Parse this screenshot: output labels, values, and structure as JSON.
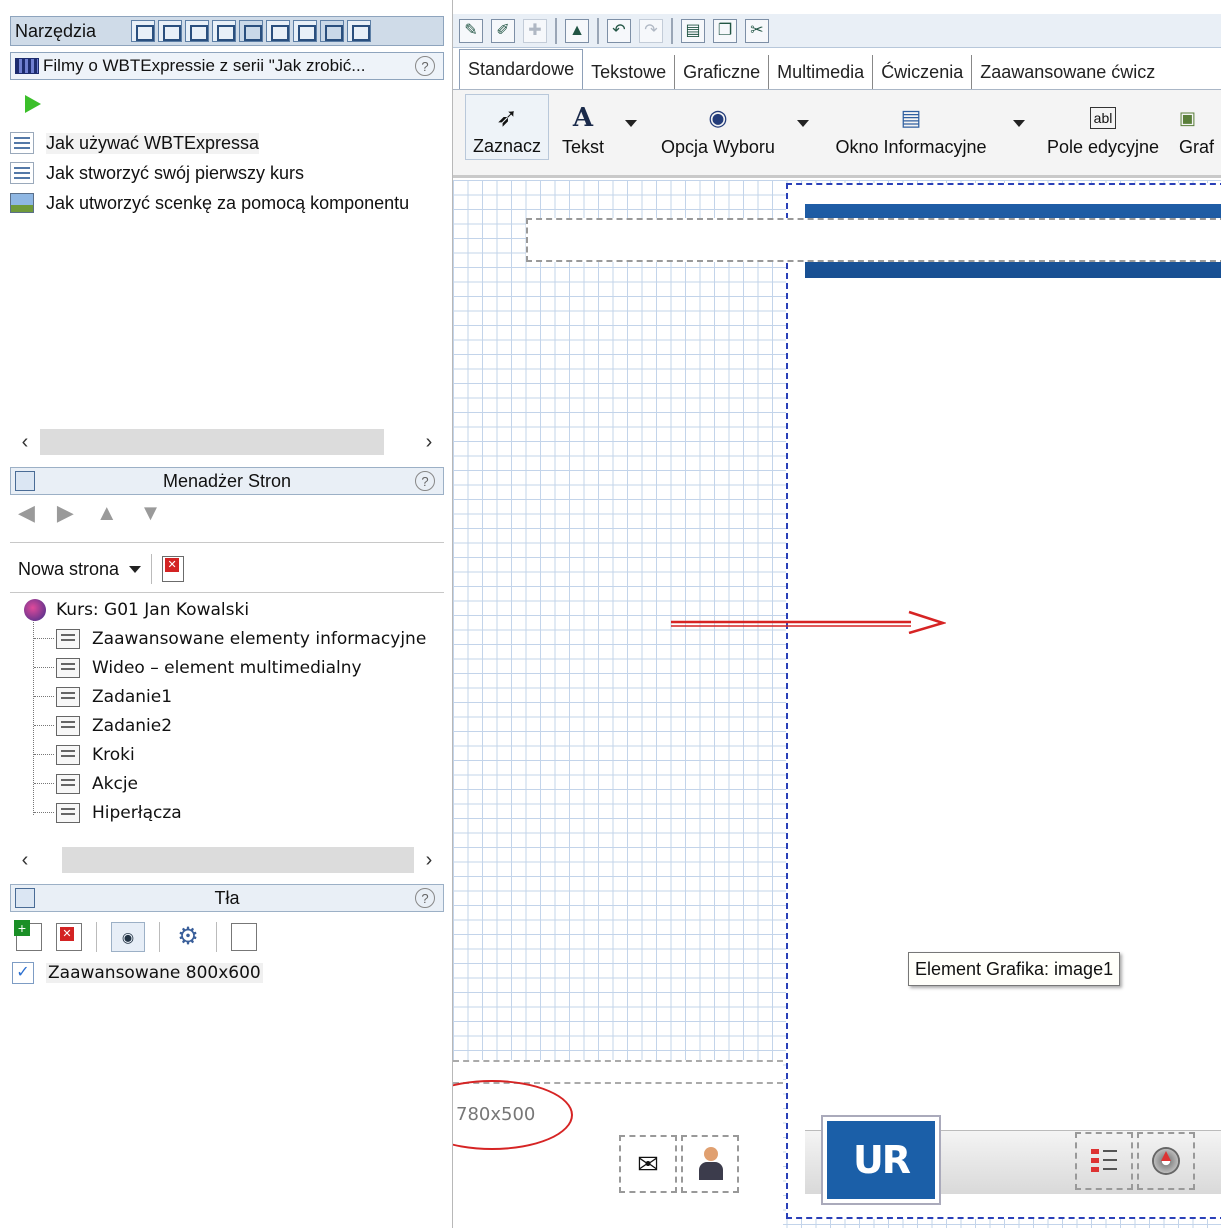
{
  "tools_panel": {
    "title": "Narzędzia",
    "icons": [
      "frame-icon",
      "import-icon",
      "tree-icon",
      "page-icon",
      "layers-icon",
      "select-region-icon",
      "preview-icon",
      "film-icon",
      "add-icon"
    ]
  },
  "videos_panel": {
    "title": "Filmy o WBTExpressie z serii \"Jak zrobić...",
    "help": "?",
    "items": [
      {
        "label": "Jak używać WBTExpressa",
        "icon": "document-icon"
      },
      {
        "label": "Jak stworzyć swój pierwszy kurs",
        "icon": "document-icon"
      },
      {
        "label": "Jak utworzyć scenkę za pomocą komponentu",
        "icon": "image-icon"
      }
    ]
  },
  "page_manager": {
    "title": "Menadżer Stron",
    "help": "?",
    "new_page_label": "Nowa strona",
    "course": "Kurs: G01 Jan Kowalski",
    "pages": [
      "Zaawansowane elementy informacyjne",
      "Wideo – element multimedialny",
      "Zadanie1",
      "Zadanie2",
      "Kroki",
      "Akcje",
      "Hiperłącza"
    ]
  },
  "backgrounds": {
    "title": "Tła",
    "help": "?",
    "items": [
      {
        "label": "Zaawansowane 800x600",
        "checked": true
      }
    ]
  },
  "tabs": [
    "Standardowe",
    "Tekstowe",
    "Graficzne",
    "Multimedia",
    "Ćwiczenia",
    "Zaawansowane ćwicz"
  ],
  "active_tab": "Standardowe",
  "ribbon": {
    "select": "Zaznacz",
    "text": "Tekst",
    "option": "Opcja Wyboru",
    "info_window": "Okno Informacyjne",
    "edit_field": "Pole edycyjne",
    "graphic": "Graf"
  },
  "canvas": {
    "tooltip": "Element Grafika: image1",
    "resolution": "780x500",
    "logo_text": "UR"
  },
  "colors": {
    "accent_blue": "#1b5fa8",
    "annotation_red": "#d62424",
    "grid": "#c3d4ea"
  }
}
